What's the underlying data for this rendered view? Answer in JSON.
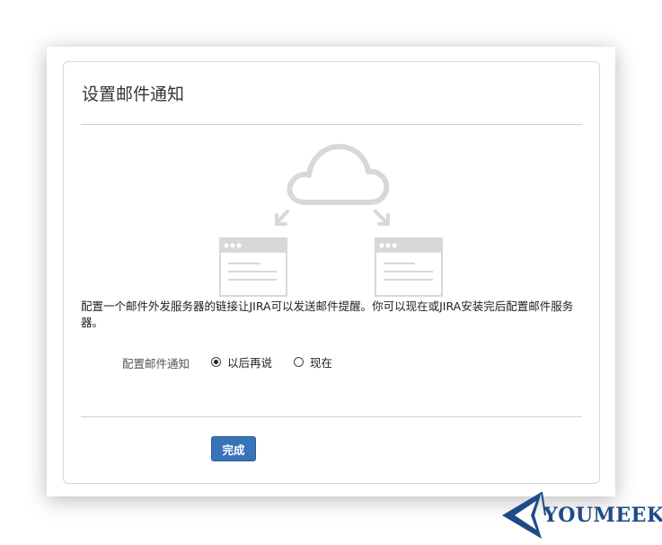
{
  "dialog": {
    "title": "设置邮件通知",
    "description": "配置一个邮件外发服务器的链接让JIRA可以发送邮件提醒。你可以现在或JIRA安装完后配置邮件服务器。",
    "field_label": "配置邮件通知",
    "options": [
      {
        "label": "以后再说",
        "selected": true
      },
      {
        "label": "现在",
        "selected": false
      }
    ],
    "finish_label": "完成"
  },
  "logo": {
    "text": "YOUMEEK"
  },
  "colors": {
    "button": "#3873b9",
    "illustration": "#d8d8d8",
    "logo": "#1f4a87"
  }
}
